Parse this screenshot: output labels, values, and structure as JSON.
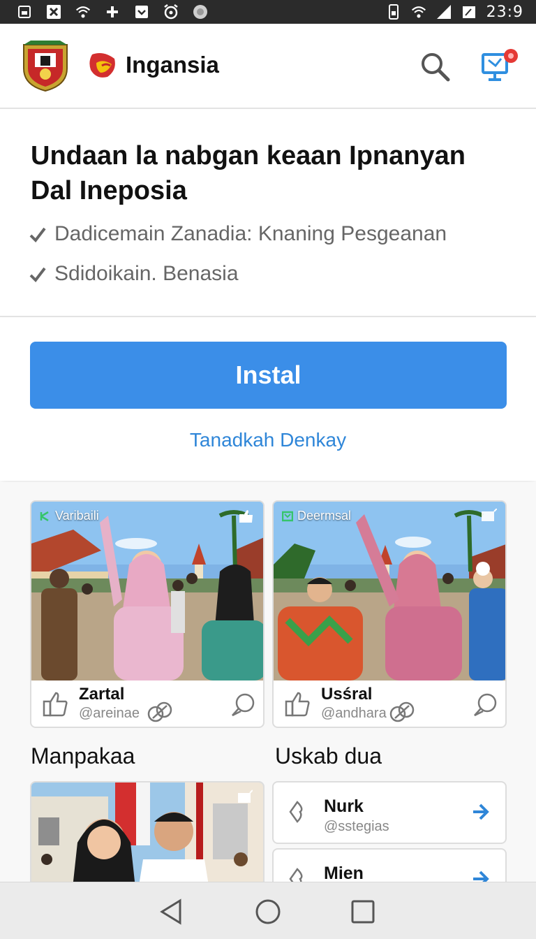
{
  "status_bar": {
    "time": "23:9",
    "left_icons": [
      "screenshot-icon",
      "close-box-icon",
      "wifi-icon",
      "plus-icon",
      "download-icon",
      "alarm-icon",
      "spinner-icon"
    ],
    "right_icons": [
      "sim-icon",
      "wifi-icon",
      "signal-icon",
      "battery-icon"
    ]
  },
  "header": {
    "brand_name": "Ingansia",
    "icons": [
      "crest-logo-icon",
      "brand-logo-icon",
      "search-icon",
      "notification-monitor-icon"
    ]
  },
  "intro": {
    "title": "Undaan la nabgan keaan Ipnanyan Dal Ineposia",
    "checks": [
      "Dadicemain Zanadia: Knaning Pesgeanan",
      "Sdidoikain. Benasia"
    ]
  },
  "install": {
    "button_label": "Instal",
    "secondary_link": "Tanadkah Denkay"
  },
  "feed": {
    "cards": [
      {
        "tag": "Varibaili",
        "user": "Zartal",
        "handle": "@areinae"
      },
      {
        "tag": "Deermsal",
        "user": "Usśral",
        "handle": "@andhara"
      }
    ],
    "section_left": "Manpakaa",
    "section_right": "Uskab dua",
    "list": [
      {
        "name": "Nurk",
        "handle": "@sstegias"
      },
      {
        "name": "Mien",
        "handle": ""
      }
    ]
  },
  "colors": {
    "accent": "#3b8ee8",
    "link": "#2f86d8",
    "status_bar": "#2b2b2b",
    "badge": "#e53935"
  },
  "navbar": {
    "icons": [
      "back-icon",
      "home-icon",
      "recents-icon"
    ]
  }
}
